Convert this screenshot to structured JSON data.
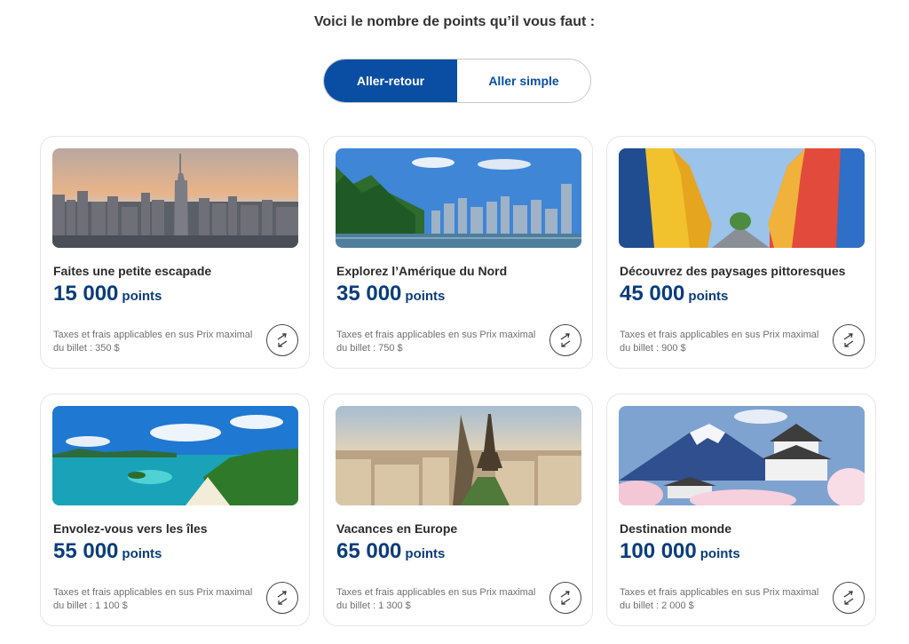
{
  "heading": "Voici le nombre de points qu’il vous faut :",
  "toggle": {
    "options": [
      "Aller-retour",
      "Aller simple"
    ],
    "selected": "Aller-retour"
  },
  "colors": {
    "accent": "#0a4ea3",
    "points": "#0a3d7a"
  },
  "cards": [
    {
      "title": "Faites une petite escapade",
      "points": "15 000",
      "unit": "points",
      "note": "Taxes et frais applicables en sus Prix maximal du billet : 350 $",
      "image": "new-york-skyline"
    },
    {
      "title": "Explorez l’Amérique du Nord",
      "points": "35 000",
      "unit": "points",
      "note": "Taxes et frais applicables en sus Prix maximal du billet : 750 $",
      "image": "vancouver-harbour"
    },
    {
      "title": "Découvrez des paysages pittoresques",
      "points": "45 000",
      "unit": "points",
      "note": "Taxes et frais applicables en sus Prix maximal du billet : 900 $",
      "image": "colorful-street"
    },
    {
      "title": "Envolez-vous vers les îles",
      "points": "55 000",
      "unit": "points",
      "note": "Taxes et frais applicables en sus Prix maximal du billet : 1 100 $",
      "image": "tropical-beach"
    },
    {
      "title": "Vacances en Europe",
      "points": "65 000",
      "unit": "points",
      "note": "Taxes et frais applicables en sus Prix maximal du billet : 1 300 $",
      "image": "paris-eiffel-tower"
    },
    {
      "title": "Destination monde",
      "points": "100 000",
      "unit": "points",
      "note": "Taxes et frais applicables en sus Prix maximal du billet : 2 000 $",
      "image": "mount-fuji-castle"
    }
  ]
}
